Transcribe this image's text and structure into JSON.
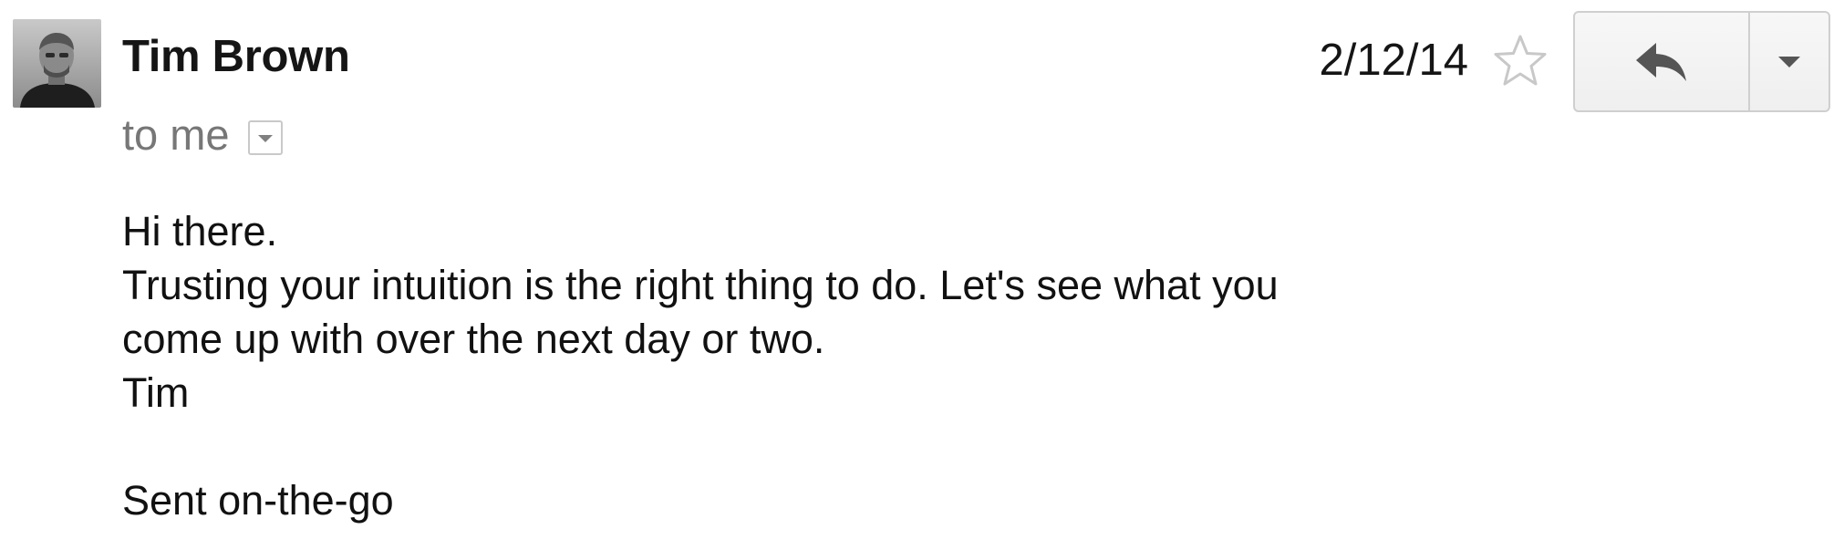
{
  "message": {
    "sender_name": "Tim Brown",
    "recipient_line": "to me",
    "date": "2/12/14",
    "body_lines": [
      "Hi there.",
      "Trusting your intuition is the right thing to do. Let's see what you",
      "come up with over the next day or two.",
      "Tim"
    ],
    "signature": "Sent on-the-go"
  },
  "icons": {
    "avatar": "sender-avatar",
    "details_toggle": "chevron-down-icon",
    "star": "star-icon",
    "reply": "reply-icon",
    "more": "dropdown-arrow-icon"
  },
  "colors": {
    "sender_text": "#151515",
    "secondary_text": "#777777",
    "button_border": "#cfcfcf",
    "button_bg": "#f2f2f2",
    "star_outline": "#c8c8c8"
  }
}
